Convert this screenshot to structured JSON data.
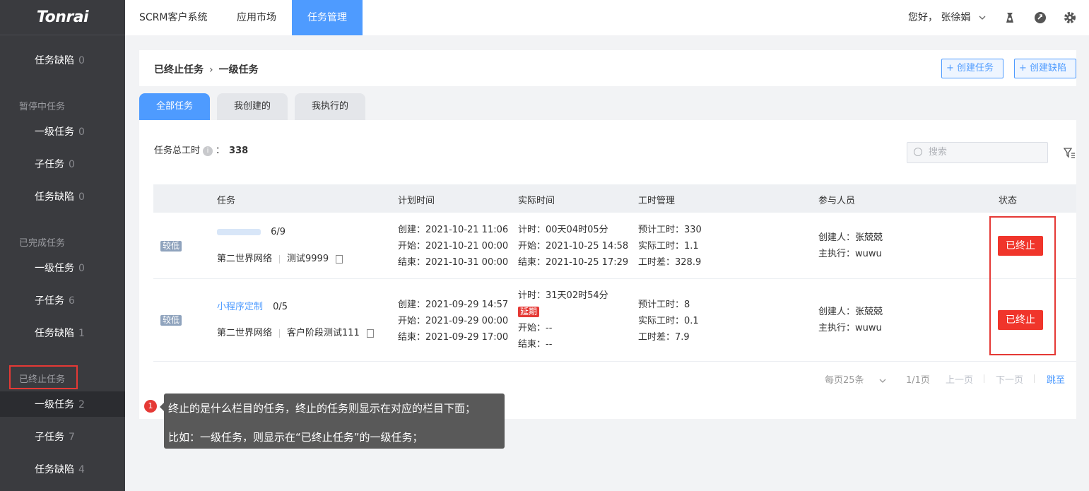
{
  "app": {
    "logo": "Tonrai"
  },
  "topnav": {
    "items": [
      "SCRM客户系统",
      "应用市场",
      "任务管理"
    ],
    "greeting": "您好， 张徐娟"
  },
  "sidebar": {
    "top_item": {
      "label": "任务缺陷",
      "count": "0"
    },
    "groups": [
      {
        "title": "暂停中任务",
        "items": [
          {
            "label": "一级任务",
            "count": "0"
          },
          {
            "label": "子任务",
            "count": "0"
          },
          {
            "label": "任务缺陷",
            "count": "0"
          }
        ]
      },
      {
        "title": "已完成任务",
        "items": [
          {
            "label": "一级任务",
            "count": "0"
          },
          {
            "label": "子任务",
            "count": "6"
          },
          {
            "label": "任务缺陷",
            "count": "1"
          }
        ]
      },
      {
        "title": "已终止任务",
        "items": [
          {
            "label": "一级任务",
            "count": "2"
          },
          {
            "label": "子任务",
            "count": "7"
          },
          {
            "label": "任务缺陷",
            "count": "4"
          }
        ]
      }
    ]
  },
  "breadcrumb": {
    "parent": "已终止任务",
    "current": "一级任务"
  },
  "actions": {
    "create_task": "+ 创建任务",
    "create_defect": "+ 创建缺陷"
  },
  "tabs": [
    "全部任务",
    "我创建的",
    "我执行的"
  ],
  "summary": {
    "label": "任务总工时",
    "info": "i",
    "colon": "：",
    "value": "338"
  },
  "search": {
    "placeholder": "搜索"
  },
  "table": {
    "headers": [
      "任务",
      "计划时间",
      "实际时间",
      "工时管理",
      "参与人员",
      "状态"
    ],
    "rows": [
      {
        "priority": "较低",
        "name": "",
        "progress": "6/9",
        "company": "第二世界网络",
        "project": "测试9999",
        "plan": [
          "创建：2021-10-21 11:06",
          "开始：2021-10-21 00:00",
          "结束：2021-10-31 00:00"
        ],
        "actual": [
          "计时：00天04时05分",
          "开始：2021-10-25 14:58",
          "结束：2021-10-25 17:29"
        ],
        "late_tag": "",
        "hours": [
          "预计工时：330",
          "实际工时：1.1",
          "工时差：328.9"
        ],
        "people": [
          "创建人：张兢兢",
          "主执行：wuwu"
        ],
        "status": "已终止"
      },
      {
        "priority": "较低",
        "name": "小程序定制",
        "progress": "0/5",
        "company": "第二世界网络",
        "project": "客户阶段测试111",
        "plan": [
          "创建：2021-09-29 14:57",
          "开始：2021-09-29 00:00",
          "结束：2021-09-29 17:00"
        ],
        "actual": [
          "计时：31天02时54分",
          "开始：--",
          "结束：--"
        ],
        "late_tag": "延期",
        "hours": [
          "预计工时：8",
          "实际工时：0.1",
          "工时差：7.9"
        ],
        "people": [
          "创建人：张兢兢",
          "主执行：wuwu"
        ],
        "status": "已终止"
      }
    ]
  },
  "pagination": {
    "per_page": "每页25条",
    "page": "1/1页",
    "prev": "上一页",
    "next": "下一页",
    "jump": "跳至"
  },
  "tooltip": {
    "number": "1",
    "line1": "终止的是什么栏目的任务，终止的任务则显示在对应的栏目下面；",
    "line2": "比如：一级任务，则显示在“已终止任务”的一级任务；"
  },
  "colors": {
    "accent": "#4e9bff",
    "danger": "#f0352b",
    "sidebar": "#3a3b3f"
  }
}
